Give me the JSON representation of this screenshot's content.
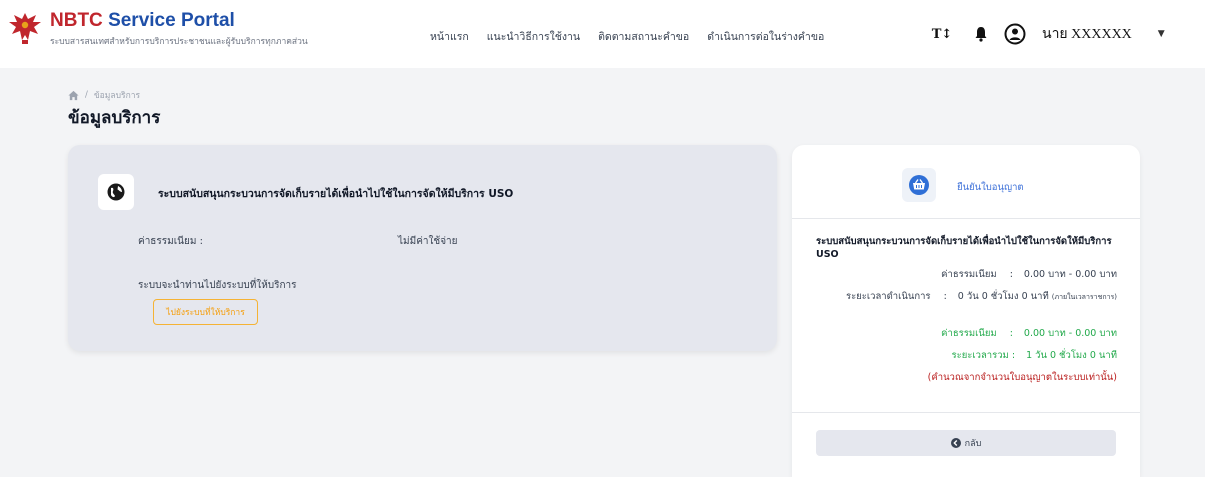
{
  "header": {
    "brand_main": "NBTC",
    "brand_service": "Service Portal",
    "brand_subtitle": "ระบบสารสนเทศสำหรับการบริการประชาชนและผู้รับบริการทุกภาคส่วน",
    "nav": [
      "หน้าแรก",
      "แนะนำวิธีการใช้งาน",
      "ติดตามสถานะคำขอ",
      "ดำเนินการต่อในร่างคำขอ"
    ],
    "font_size_label": "T↕",
    "user_name": "นาย XXXXXX"
  },
  "breadcrumb": {
    "separator": "/",
    "current": "ข้อมูลบริการ"
  },
  "page_title": "ข้อมูลบริการ",
  "service": {
    "name": "ระบบสนับสนุนกระบวนการจัดเก็บรายได้เพื่อนำไปใช้ในการจัดให้มีบริการ USO",
    "fee_label": "ค่าธรรมเนียม :",
    "fee_value": "ไม่มีค่าใช้จ่าย",
    "redirect_label": "ระบบจะนำท่านไปยังระบบที่ให้บริการ",
    "redirect_button": "ไปยังระบบที่ให้บริการ"
  },
  "summary": {
    "confirm_label": "ยืนยันใบอนุญาต",
    "title": "ระบบสนับสนุนกระบวนการจัดเก็บรายได้เพื่อนำไปใช้ในการจัดให้มีบริการ USO",
    "fee_label": "ค่าธรรมเนียม",
    "fee_value": "0.00 บาท - 0.00 บาท",
    "duration_label": "ระยะเวลาดำเนินการ",
    "duration_value": "0 วัน 0 ชั่วโมง 0 นาที",
    "duration_note": "(ภายในเวลาราชการ)",
    "total_fee_label": "ค่าธรรมเนียม",
    "total_fee_value": "0.00 บาท - 0.00 บาท",
    "total_time_label": "ระยะเวลารวม :",
    "total_time_value": "1 วัน 0 ชั่วโมง 0 นาที",
    "note": "(คำนวณจากจำนวนใบอนุญาตในระบบเท่านั้น)",
    "colon": ":",
    "back_button": "กลับ"
  },
  "colors": {
    "brand_red": "#c0262d",
    "brand_blue": "#1e4fa8",
    "accent_orange": "#f59e0b",
    "green": "#22a94b",
    "red": "#b91c1c"
  }
}
